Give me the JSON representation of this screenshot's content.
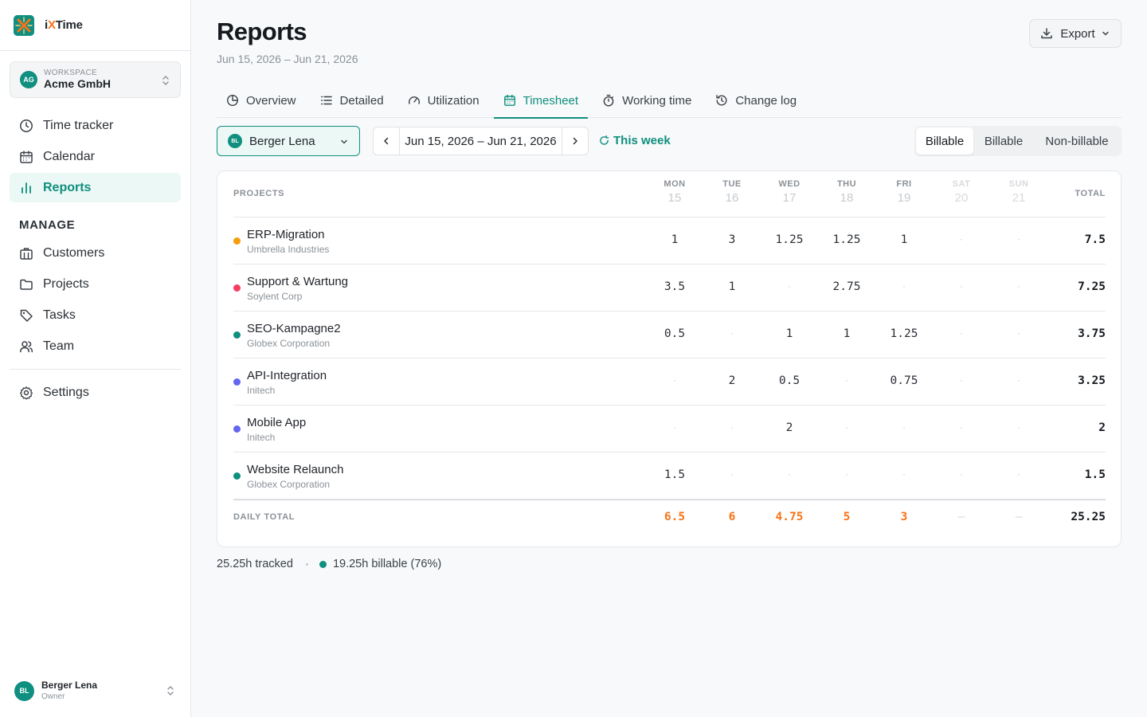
{
  "app": {
    "brand_prefix": "i",
    "brand_x": "X",
    "brand_suffix": "Time",
    "colors": {
      "accent": "#0f8f7f",
      "orange": "#f97316"
    }
  },
  "workspace": {
    "initials": "AG",
    "label": "WORKSPACE",
    "name": "Acme GmbH"
  },
  "nav": {
    "items": [
      {
        "label": "Time tracker",
        "icon": "clock-icon"
      },
      {
        "label": "Calendar",
        "icon": "calendar-icon"
      },
      {
        "label": "Reports",
        "icon": "bar-chart-icon",
        "active": true
      }
    ],
    "manage_heading": "MANAGE",
    "manage_items": [
      {
        "label": "Customers",
        "icon": "building-icon"
      },
      {
        "label": "Projects",
        "icon": "folder-icon"
      },
      {
        "label": "Tasks",
        "icon": "tag-icon"
      },
      {
        "label": "Team",
        "icon": "users-icon"
      }
    ],
    "settings": {
      "label": "Settings",
      "icon": "gear-icon"
    }
  },
  "user": {
    "initials": "BL",
    "name": "Berger Lena",
    "role": "Owner"
  },
  "page": {
    "title": "Reports",
    "subtitle": "Jun 15, 2026 – Jun 21, 2026",
    "export_label": "Export"
  },
  "tabs": [
    {
      "label": "Overview",
      "icon": "pie-chart-icon"
    },
    {
      "label": "Detailed",
      "icon": "list-icon"
    },
    {
      "label": "Utilization",
      "icon": "gauge-icon"
    },
    {
      "label": "Timesheet",
      "icon": "calendar-icon",
      "active": true
    },
    {
      "label": "Working time",
      "icon": "stopwatch-icon"
    },
    {
      "label": "Change log",
      "icon": "history-icon"
    }
  ],
  "filters": {
    "person": {
      "initials": "BL",
      "name": "Berger Lena"
    },
    "range": "Jun 15, 2026 – Jun 21, 2026",
    "this_week": "This week",
    "segments": [
      "Billable",
      "Billable",
      "Non-billable"
    ],
    "active_segment": 0
  },
  "timesheet": {
    "projects_header": "PROJECTS",
    "total_header": "TOTAL",
    "days": [
      {
        "name": "MON",
        "date": "15"
      },
      {
        "name": "TUE",
        "date": "16"
      },
      {
        "name": "WED",
        "date": "17"
      },
      {
        "name": "THU",
        "date": "18"
      },
      {
        "name": "FRI",
        "date": "19"
      },
      {
        "name": "SAT",
        "date": "20",
        "weekend": true
      },
      {
        "name": "SUN",
        "date": "21",
        "weekend": true
      }
    ],
    "empty_mark": "·",
    "rows": [
      {
        "project": "ERP-Migration",
        "customer": "Umbrella Industries",
        "color": "#f59e0b",
        "hours": [
          "1",
          "3",
          "1.25",
          "1.25",
          "1",
          "",
          ""
        ],
        "total": "7.5"
      },
      {
        "project": "Support & Wartung",
        "customer": "Soylent Corp",
        "color": "#f43f5e",
        "hours": [
          "3.5",
          "1",
          "",
          "2.75",
          "",
          "",
          ""
        ],
        "total": "7.25"
      },
      {
        "project": "SEO-Kampagne2",
        "customer": "Globex Corporation",
        "color": "#0f8f7f",
        "hours": [
          "0.5",
          "",
          "1",
          "1",
          "1.25",
          "",
          ""
        ],
        "total": "3.75"
      },
      {
        "project": "API-Integration",
        "customer": "Initech",
        "color": "#6366f1",
        "hours": [
          "",
          "2",
          "0.5",
          "",
          "0.75",
          "",
          ""
        ],
        "total": "3.25"
      },
      {
        "project": "Mobile App",
        "customer": "Initech",
        "color": "#6366f1",
        "hours": [
          "",
          "",
          "2",
          "",
          "",
          "",
          ""
        ],
        "total": "2"
      },
      {
        "project": "Website Relaunch",
        "customer": "Globex Corporation",
        "color": "#0f8f7f",
        "hours": [
          "1.5",
          "",
          "",
          "",
          "",
          "",
          ""
        ],
        "total": "1.5"
      }
    ],
    "daily_total_label": "DAILY TOTAL",
    "daily_totals": [
      "6.5",
      "6",
      "4.75",
      "5",
      "3",
      "–",
      "–"
    ],
    "grand_total": "25.25"
  },
  "summary": {
    "tracked": "25.25h tracked",
    "billable": "19.25h billable (76%)"
  }
}
